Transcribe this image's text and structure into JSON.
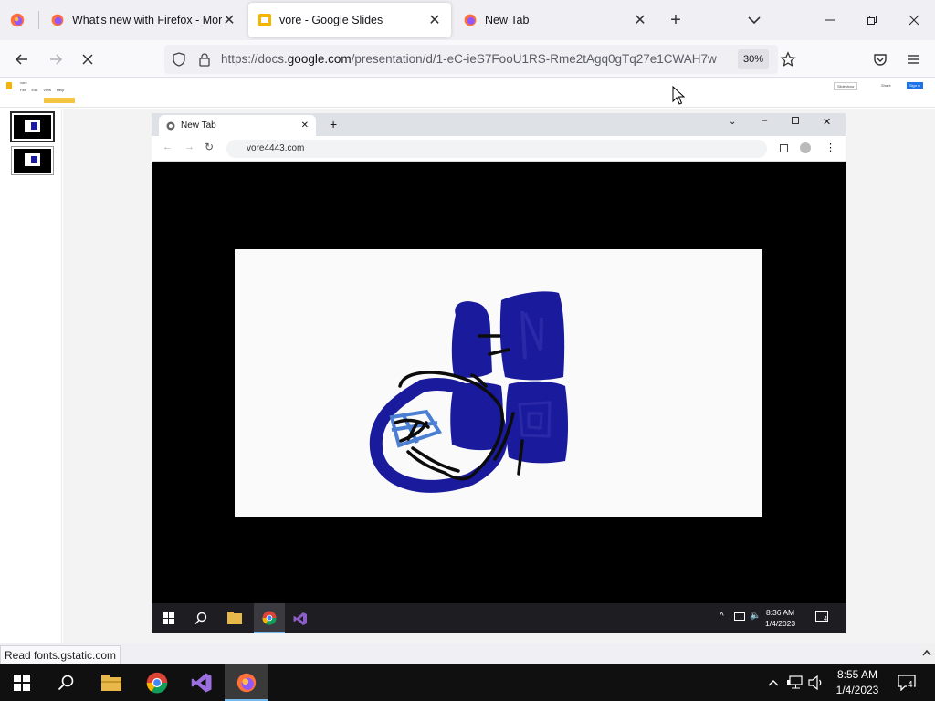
{
  "browser": {
    "tabs": [
      {
        "title": "What's new with Firefox - More",
        "active": false
      },
      {
        "title": "vore - Google Slides",
        "active": true
      },
      {
        "title": "New Tab",
        "active": false
      }
    ],
    "url_prefix": "https://docs.",
    "url_domain": "google.com",
    "url_rest": "/presentation/d/1-eC-ieS7FooU1RS-Rme2tAgq0gTq27e1CWAH7w",
    "zoom": "30%",
    "status": "Read fonts.gstatic.com"
  },
  "slides_app": {
    "doc_title": "vore",
    "menu": [
      "File",
      "Edit",
      "View",
      "Help"
    ],
    "slideshow_label": "Slideshow",
    "share_label": "Share",
    "signin_label": "Sign in"
  },
  "slide_content": {
    "chrome_tab_title": "New Tab",
    "chrome_url": "vore4443.com",
    "inner_time": "8:36 AM",
    "inner_date": "1/4/2023",
    "inner_notification_count": "4"
  },
  "taskbar": {
    "time": "8:55 AM",
    "date": "1/4/2023",
    "notification_count": "4"
  },
  "colors": {
    "firefox_bg": "#f0f0f4",
    "drawing_blue": "#1a1a9c",
    "drawing_light_blue": "#4a7fd4",
    "taskbar_accent": "#76b9ed"
  }
}
